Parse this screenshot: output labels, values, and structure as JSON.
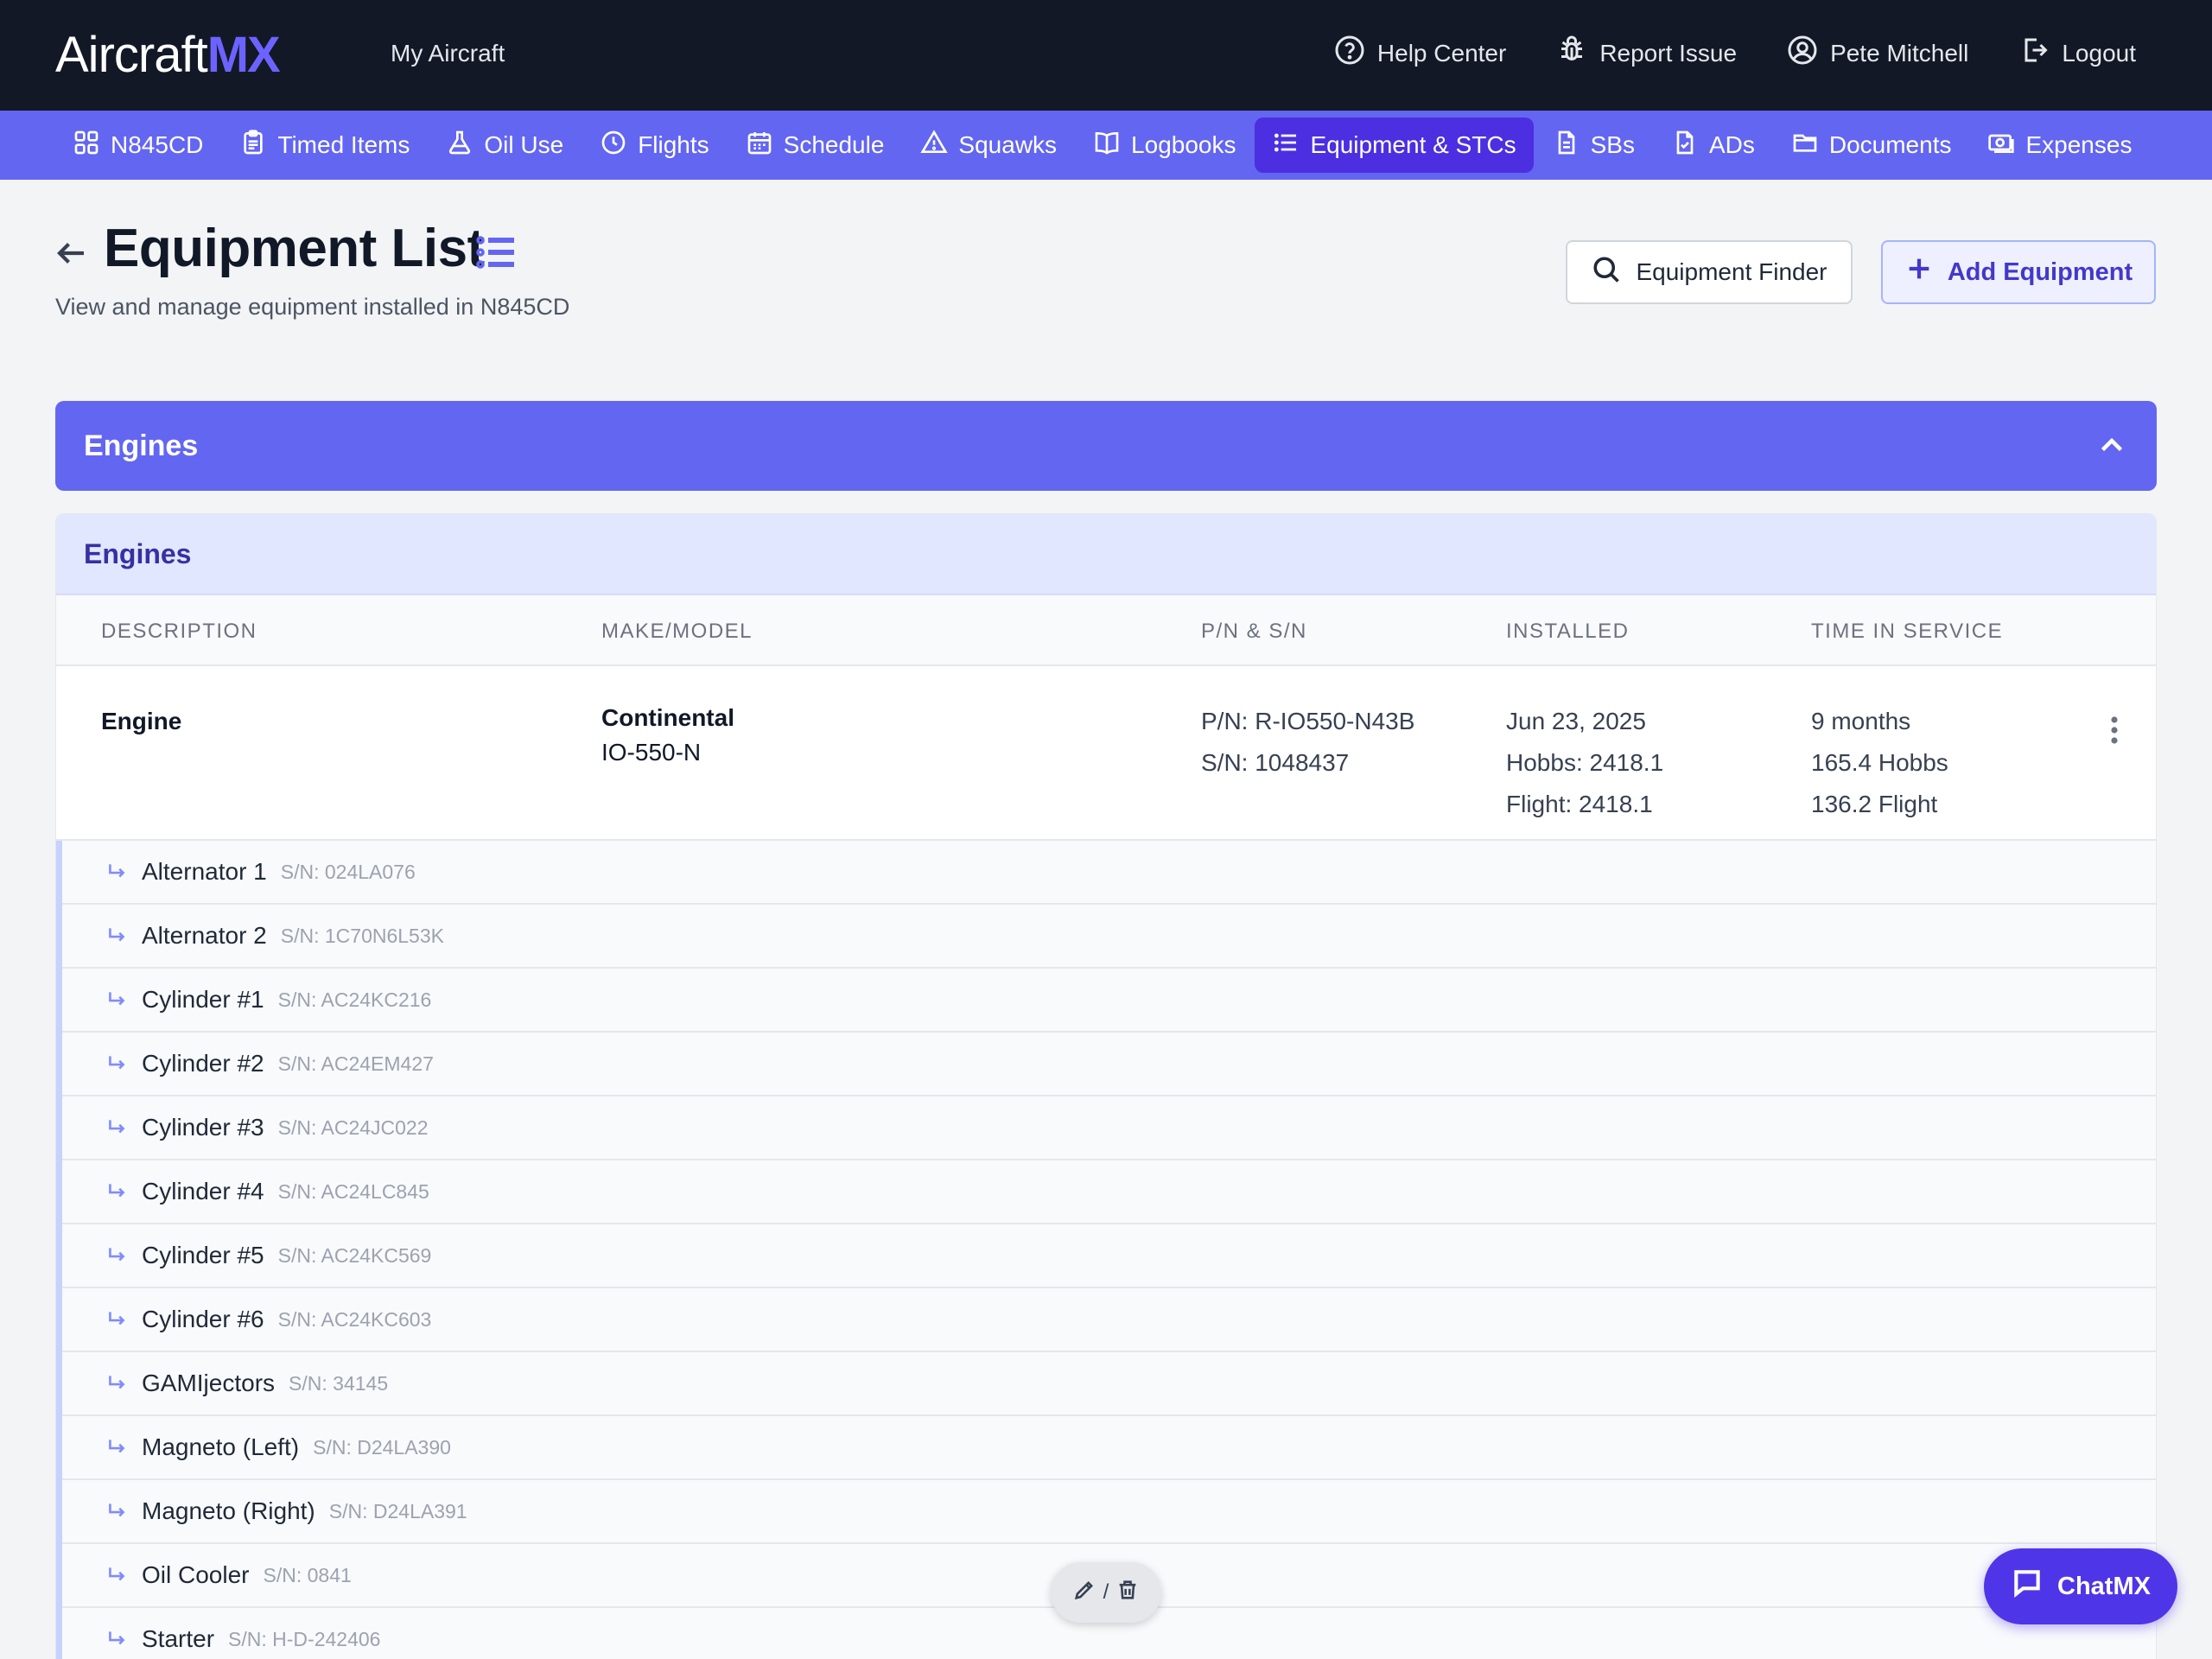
{
  "brand": {
    "name_part1": "Aircraft",
    "name_part2": "MX"
  },
  "topbar": {
    "my_aircraft": "My Aircraft",
    "help": "Help Center",
    "report": "Report Issue",
    "user": "Pete Mitchell",
    "logout": "Logout"
  },
  "nav": [
    {
      "label": "N845CD",
      "icon": "grid-icon"
    },
    {
      "label": "Timed Items",
      "icon": "clipboard-icon"
    },
    {
      "label": "Oil Use",
      "icon": "flask-icon"
    },
    {
      "label": "Flights",
      "icon": "clock-icon"
    },
    {
      "label": "Schedule",
      "icon": "calendar-icon"
    },
    {
      "label": "Squawks",
      "icon": "warning-icon"
    },
    {
      "label": "Logbooks",
      "icon": "book-icon"
    },
    {
      "label": "Equipment & STCs",
      "icon": "list-icon",
      "active": true
    },
    {
      "label": "SBs",
      "icon": "document-icon"
    },
    {
      "label": "ADs",
      "icon": "document-check-icon"
    },
    {
      "label": "Documents",
      "icon": "folder-icon"
    },
    {
      "label": "Expenses",
      "icon": "cash-icon"
    }
  ],
  "header": {
    "title": "Equipment List",
    "subtitle": "View and manage equipment installed in N845CD",
    "finder_label": "Equipment Finder",
    "add_label": "Add Equipment"
  },
  "section": {
    "title": "Engines"
  },
  "card": {
    "title": "Engines",
    "columns": [
      "DESCRIPTION",
      "MAKE/MODEL",
      "P/N & S/N",
      "INSTALLED",
      "TIME IN SERVICE"
    ],
    "engine": {
      "description": "Engine",
      "make": "Continental",
      "model": "IO-550-N",
      "pn": "P/N: R-IO550-N43B",
      "sn": "S/N: 1048437",
      "installed_date": "Jun 23, 2025",
      "installed_hobbs": "Hobbs: 2418.1",
      "installed_flight": "Flight: 2418.1",
      "tis_months": "9 months",
      "tis_hobbs": "165.4 Hobbs",
      "tis_flight": "136.2 Flight"
    },
    "components": [
      {
        "name": "Alternator 1",
        "sn": "S/N: 024LA076"
      },
      {
        "name": "Alternator 2",
        "sn": "S/N: 1C70N6L53K"
      },
      {
        "name": "Cylinder #1",
        "sn": "S/N: AC24KC216"
      },
      {
        "name": "Cylinder #2",
        "sn": "S/N: AC24EM427"
      },
      {
        "name": "Cylinder #3",
        "sn": "S/N: AC24JC022"
      },
      {
        "name": "Cylinder #4",
        "sn": "S/N: AC24LC845"
      },
      {
        "name": "Cylinder #5",
        "sn": "S/N: AC24KC569"
      },
      {
        "name": "Cylinder #6",
        "sn": "S/N: AC24KC603"
      },
      {
        "name": "GAMIjectors",
        "sn": "S/N: 34145"
      },
      {
        "name": "Magneto (Left)",
        "sn": "S/N: D24LA390"
      },
      {
        "name": "Magneto (Right)",
        "sn": "S/N: D24LA391"
      },
      {
        "name": "Oil Cooler",
        "sn": "S/N: 0841"
      },
      {
        "name": "Starter",
        "sn": "S/N: H-D-242406"
      }
    ]
  },
  "floating": {
    "edit_separator": "/",
    "chat_label": "ChatMX"
  },
  "colors": {
    "topbar": "#121826",
    "accent": "#6366f1",
    "active_nav": "#4c2fe0",
    "chat": "#4f35e8"
  }
}
